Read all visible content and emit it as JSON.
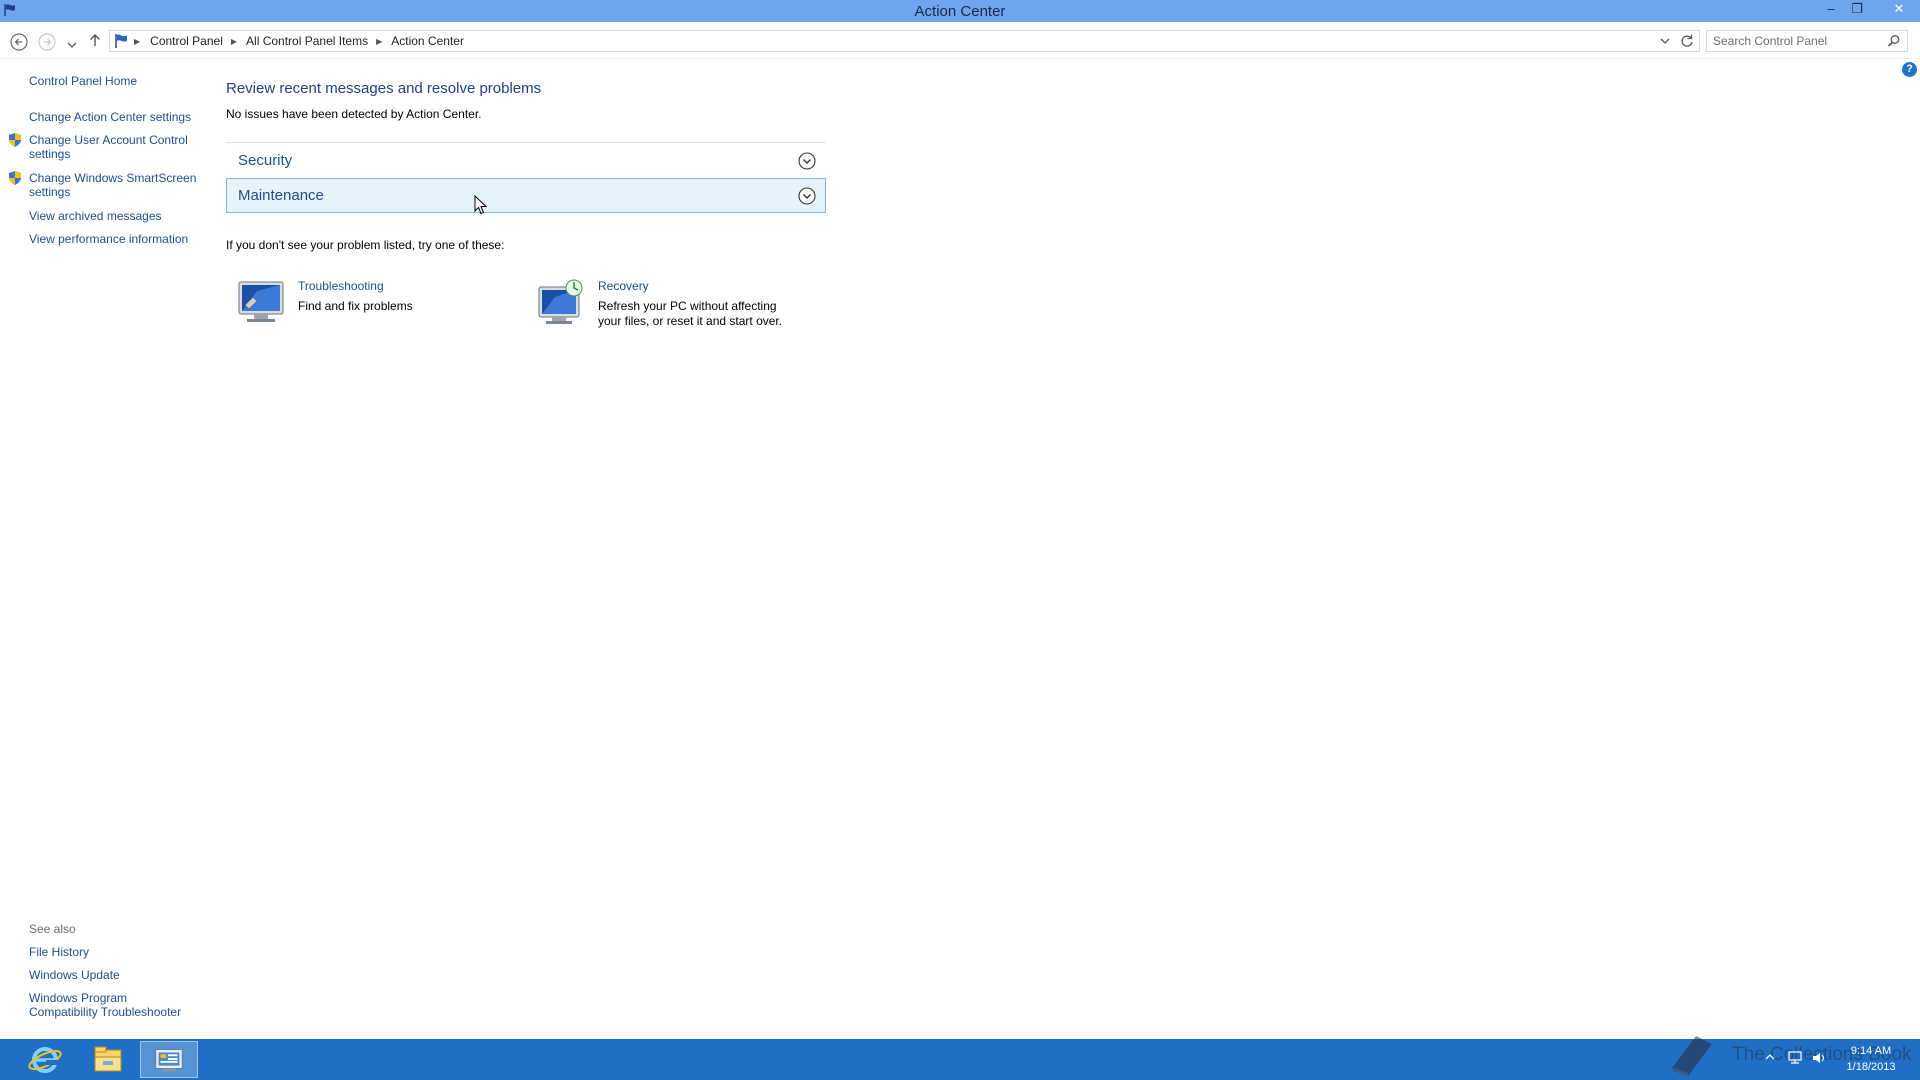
{
  "window": {
    "title": "Action Center",
    "controls": {
      "minimize": "–",
      "maximize": "❐",
      "close": "✕"
    }
  },
  "address_bar": {
    "breadcrumbs": [
      "Control Panel",
      "All Control Panel Items",
      "Action Center"
    ],
    "search_placeholder": "Search Control Panel"
  },
  "left_pane": {
    "home_link": "Control Panel Home",
    "links": [
      {
        "label": "Change Action Center settings",
        "shield": false
      },
      {
        "label": "Change User Account Control settings",
        "shield": true
      },
      {
        "label": "Change Windows SmartScreen settings",
        "shield": true
      },
      {
        "label": "View archived messages",
        "shield": false
      },
      {
        "label": "View performance information",
        "shield": false
      }
    ],
    "see_also": {
      "heading": "See also",
      "links": [
        "File History",
        "Windows Update",
        "Windows Program Compatibility Troubleshooter"
      ]
    }
  },
  "main": {
    "title": "Review recent messages and resolve problems",
    "subtitle": "No issues have been detected by Action Center.",
    "sections": [
      {
        "label": "Security",
        "state": "collapsed"
      },
      {
        "label": "Maintenance",
        "state": "collapsed-hover"
      }
    ],
    "try_text": "If you don't see your problem listed, try one of these:",
    "tools": [
      {
        "name": "Troubleshooting",
        "description": "Find and fix problems",
        "icon": "troubleshooting-icon"
      },
      {
        "name": "Recovery",
        "description": "Refresh your PC without affecting your files, or reset it and start over.",
        "icon": "recovery-icon"
      }
    ]
  },
  "taskbar": {
    "pinned": [
      "internet-explorer-icon",
      "file-explorer-icon",
      "control-panel-icon"
    ],
    "active": "control-panel-icon",
    "clock": {
      "time": "9:14 AM",
      "date": "1/18/2013"
    },
    "watermark": "The Collections Book"
  },
  "colors": {
    "titlebar": "#6fa5ec",
    "link": "#1e4e8c",
    "heading": "#1e3f8a",
    "hover_section_bg": "#e5f3fb",
    "hover_section_border": "#7eb4ea",
    "taskbar": "#1e6fc5"
  }
}
